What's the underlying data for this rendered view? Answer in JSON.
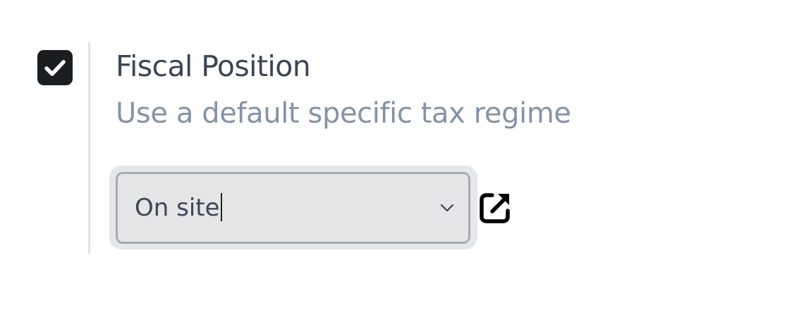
{
  "setting": {
    "checked": true,
    "title": "Fiscal Position",
    "description": "Use a default specific tax regime",
    "select": {
      "value": "On site"
    },
    "icons": {
      "checkbox": "check-icon",
      "dropdown": "chevron-down-icon",
      "open": "external-link-icon"
    }
  },
  "colors": {
    "checkbox": "#1b1e21",
    "title": "#3d4554",
    "description": "#8592a6",
    "select_border": "#a7abb0",
    "select_bg": "#e4e5e6"
  }
}
